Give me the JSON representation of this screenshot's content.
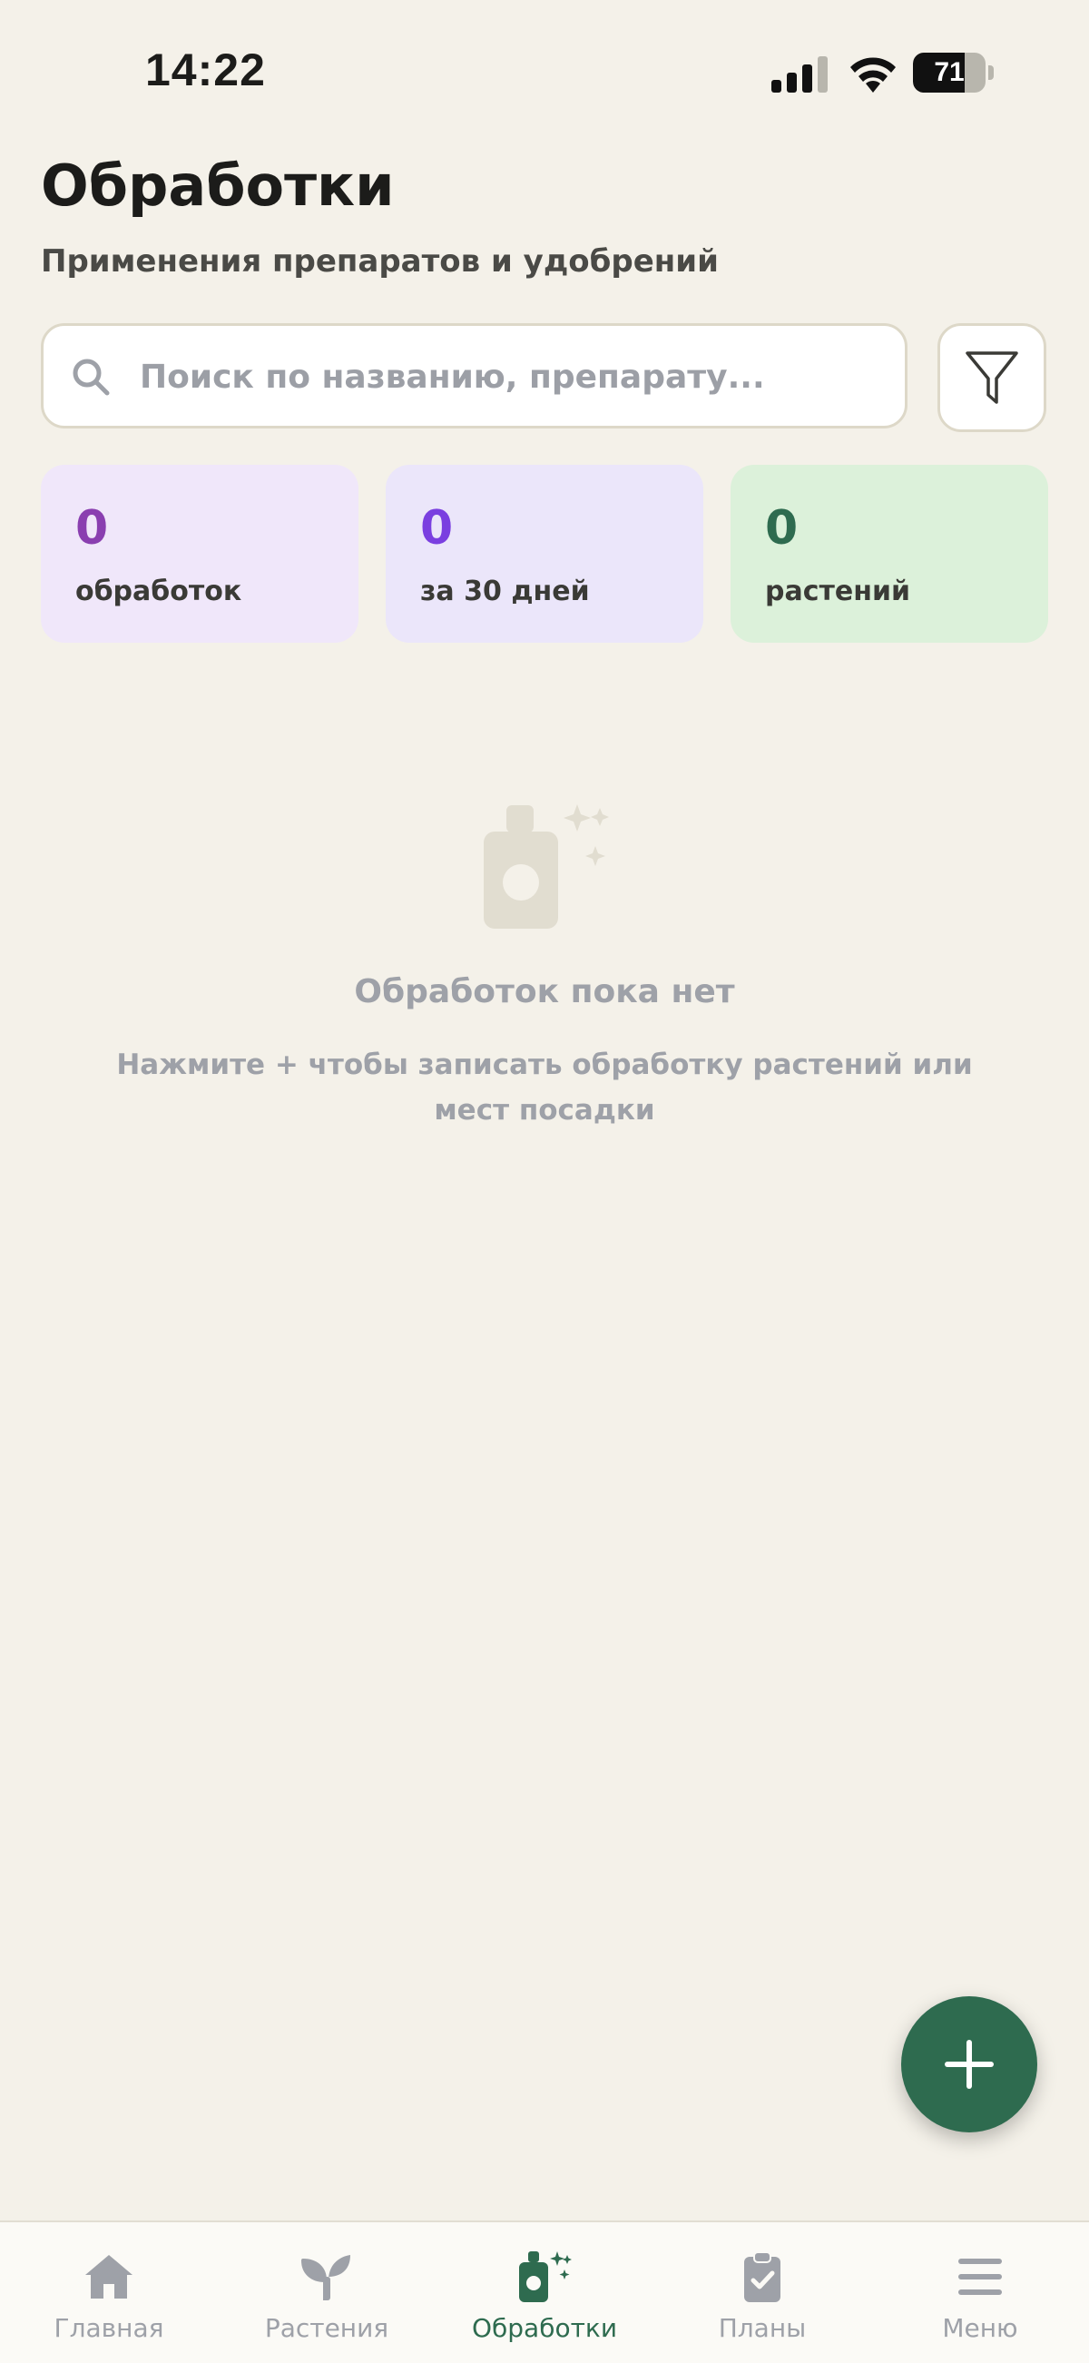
{
  "status_bar": {
    "time": "14:22",
    "battery": "71",
    "battery_level": 0.71
  },
  "header": {
    "title": "Обработки",
    "subtitle": "Применения препаратов и удобрений"
  },
  "search": {
    "placeholder": "Поиск по названию, препарату..."
  },
  "stats": [
    {
      "value": "0",
      "label": "обработок",
      "value_color": "#8a3fb0",
      "bg": "#f0e7fa"
    },
    {
      "value": "0",
      "label": "за 30 дней",
      "value_color": "#7a3fe0",
      "bg": "#ebe6fa"
    },
    {
      "value": "0",
      "label": "растений",
      "value_color": "#2e6b4f",
      "bg": "#dcf1da"
    }
  ],
  "empty_state": {
    "icon": "spray-bottle-sparkles-icon",
    "title": "Обработок пока нет",
    "description": "Нажмите + чтобы записать обработку растений или мест посадки"
  },
  "tabs": [
    {
      "label": "Главная",
      "icon": "home-icon",
      "active": false
    },
    {
      "label": "Растения",
      "icon": "sprout-icon",
      "active": false
    },
    {
      "label": "Обработки",
      "icon": "spray-bottle-icon",
      "active": true
    },
    {
      "label": "Планы",
      "icon": "clipboard-check-icon",
      "active": false
    },
    {
      "label": "Меню",
      "icon": "menu-icon",
      "active": false
    }
  ],
  "colors": {
    "accent": "#2e6b4f",
    "background": "#f4f1e9",
    "muted": "#9ea1a8"
  }
}
